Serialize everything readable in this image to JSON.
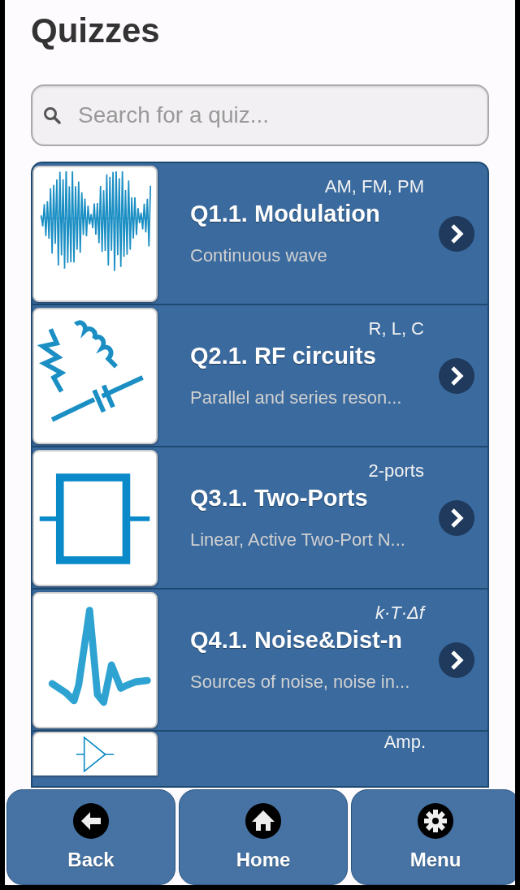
{
  "header": {
    "title": "Quizzes"
  },
  "search": {
    "placeholder": "Search for a quiz..."
  },
  "quizzes": [
    {
      "kind": "wave",
      "title": "Q1.1. Modulation",
      "tag": "AM, FM, PM",
      "tag_italic": false,
      "subtitle": "Continuous wave"
    },
    {
      "kind": "circuit",
      "title": "Q2.1. RF circuits",
      "tag": "R, L, C",
      "tag_italic": false,
      "subtitle": "Parallel and series reson..."
    },
    {
      "kind": "twoport",
      "title": "Q3.1. Two-Ports",
      "tag": "2-ports",
      "tag_italic": false,
      "subtitle": "Linear, Active Two-Port N..."
    },
    {
      "kind": "noise",
      "title": "Q4.1. Noise&Dist-n",
      "tag": "k·T·Δf",
      "tag_italic": true,
      "subtitle": "Sources of noise, noise in..."
    },
    {
      "kind": "amplifier",
      "tag": "Amp.",
      "tag_italic": false
    }
  ],
  "footer": [
    {
      "kind": "back",
      "label": "Back"
    },
    {
      "kind": "home",
      "label": "Home"
    },
    {
      "kind": "menu",
      "label": "Menu"
    }
  ]
}
